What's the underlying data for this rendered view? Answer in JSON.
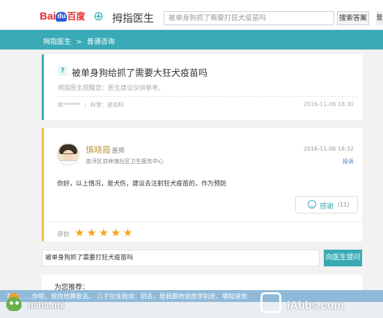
{
  "header": {
    "baidu_logo": "Baidu百度",
    "brand": "拇指医生",
    "search_value": "被单身狗抓了需要打狂犬疫苗吗",
    "search_button": "搜索答案",
    "right_edge": "登"
  },
  "breadcrumb": {
    "home": "拇指医生",
    "separator": ">",
    "current": "普通咨询"
  },
  "question": {
    "mark": "?",
    "title": "被单身狗给抓了需要大狂犬疫苗吗",
    "tip": "拇指医生提醒您：医生建议仅供参考。",
    "asker": "疯******",
    "department": "科室：感染科",
    "time": "2016-11-06 18:30"
  },
  "answer": {
    "doctor_name": "慎晓霞",
    "doctor_title": "医师",
    "org": "南浔区双林镇社区卫生服务中心",
    "time": "2016-11-06 18:32",
    "report": "投诉",
    "text": "你好，以上情况，是犬伤，建议去注射狂犬疫苗的，作为预防",
    "thanks_label": "感谢",
    "thanks_count": "(11)",
    "rating_label": "评价",
    "rating": 5,
    "stars": "★★★★★"
  },
  "ask": {
    "input_value": "被单身狗抓了需要打狂犬疫苗吗",
    "button": "向医生提问"
  },
  "recommend": {
    "title": "为您推荐："
  },
  "ticker": {
    "text": "打工……你呢，我找他算账去。 儿子拉住我说：别去，是我跟他说放学别走，哪知道他"
  },
  "watermarks": {
    "left": "haha.mx",
    "right": "iAbbs.com"
  }
}
